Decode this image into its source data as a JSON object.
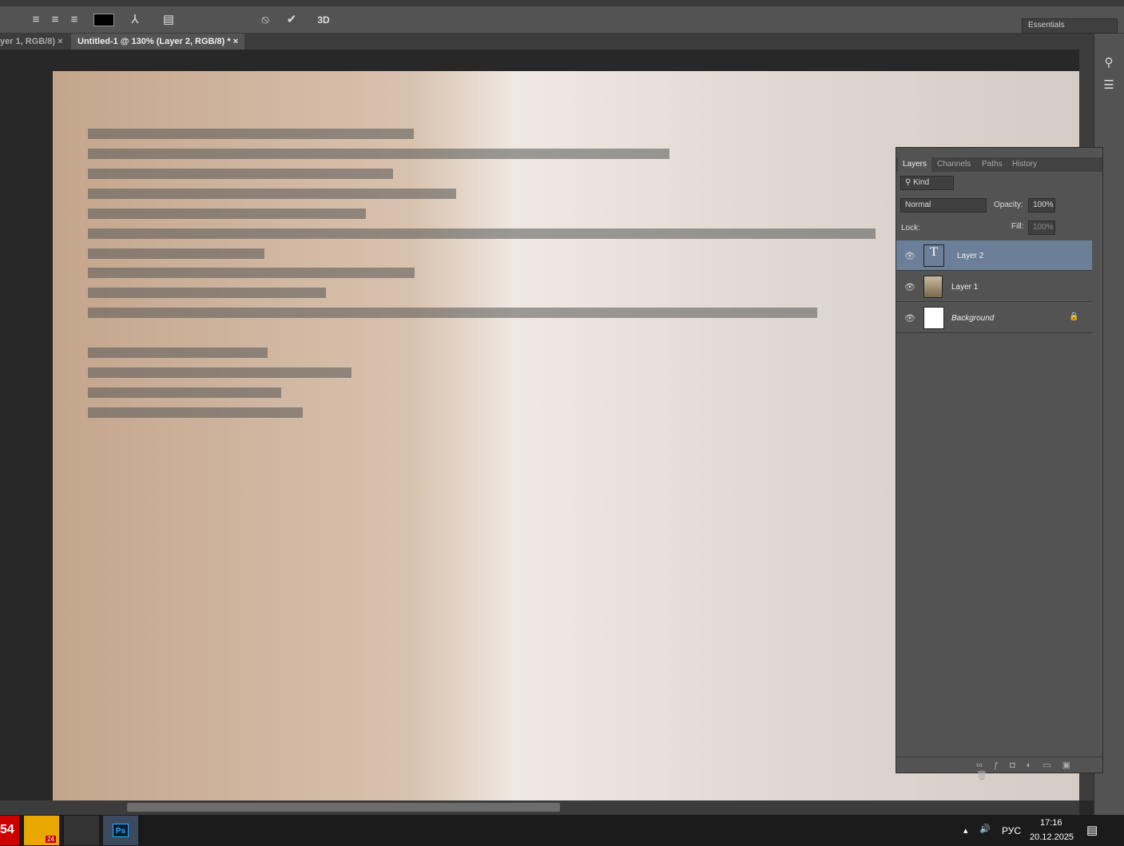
{
  "options_bar": {
    "workspace": "Essentials",
    "threed": "3D"
  },
  "tabs": [
    {
      "label": "yer 1, RGB/8)",
      "active": false
    },
    {
      "label": "Untitled-1 @ 130% (Layer 2, RGB/8) *",
      "active": true
    }
  ],
  "canvas": {
    "text_lines_redacted": 15
  },
  "layers_panel": {
    "tabs": [
      "Layers",
      "Channels",
      "Paths",
      "History"
    ],
    "filter": "Kind",
    "blend_mode": "Normal",
    "opacity_label": "Opacity:",
    "opacity": "100%",
    "lock_label": "Lock:",
    "fill_label": "Fill:",
    "fill": "100%",
    "layers": [
      {
        "name": "Layer 2",
        "type": "text",
        "selected": true
      },
      {
        "name": "Layer 1",
        "type": "image",
        "selected": false
      },
      {
        "name": "Background",
        "type": "background",
        "selected": false
      }
    ]
  },
  "taskbar": {
    "lang": "РУС",
    "time": "17:16",
    "date": "20.12.2025",
    "badge": "24",
    "left_badge": "54"
  }
}
